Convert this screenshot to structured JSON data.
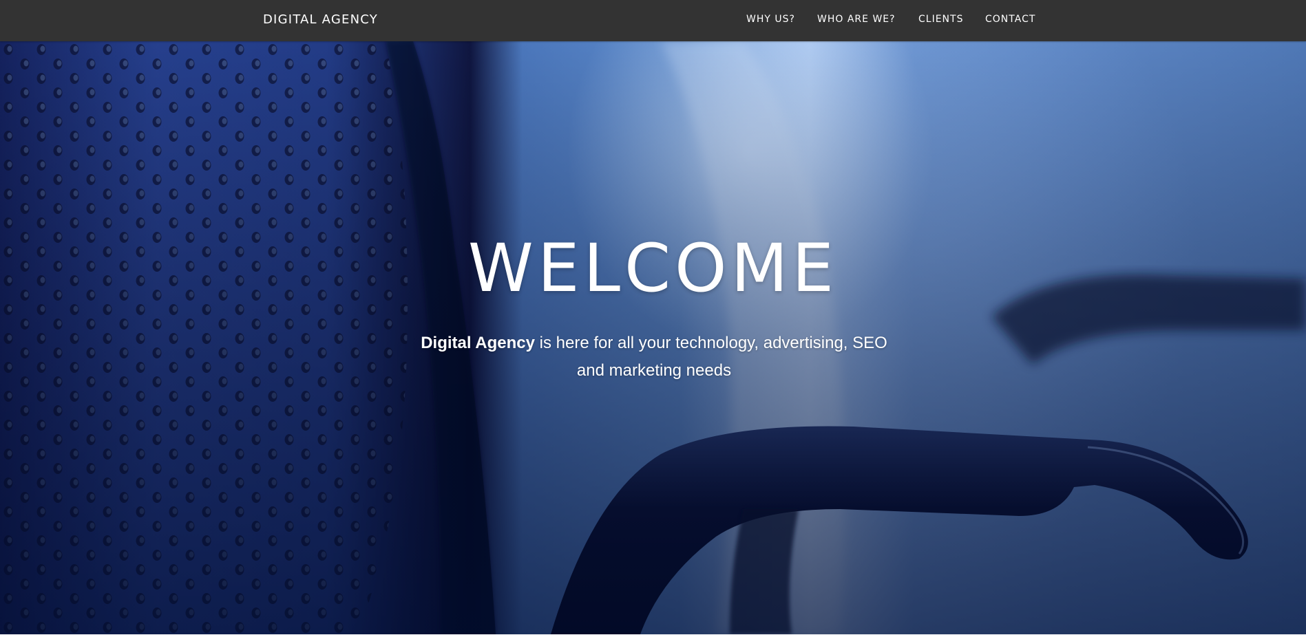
{
  "header": {
    "brand": "DIGITAL AGENCY",
    "nav": [
      {
        "label": "WHY US?"
      },
      {
        "label": "WHO ARE WE?"
      },
      {
        "label": "CLIENTS"
      },
      {
        "label": "CONTACT"
      }
    ]
  },
  "hero": {
    "title": "WELCOME",
    "tagline_bold": "Digital Agency",
    "tagline_rest": " is here for all your technology, advertising, SEO and marketing needs"
  },
  "colors": {
    "navbar": "#333333",
    "text": "#ffffff",
    "hero_tint": "#4f78b6"
  }
}
